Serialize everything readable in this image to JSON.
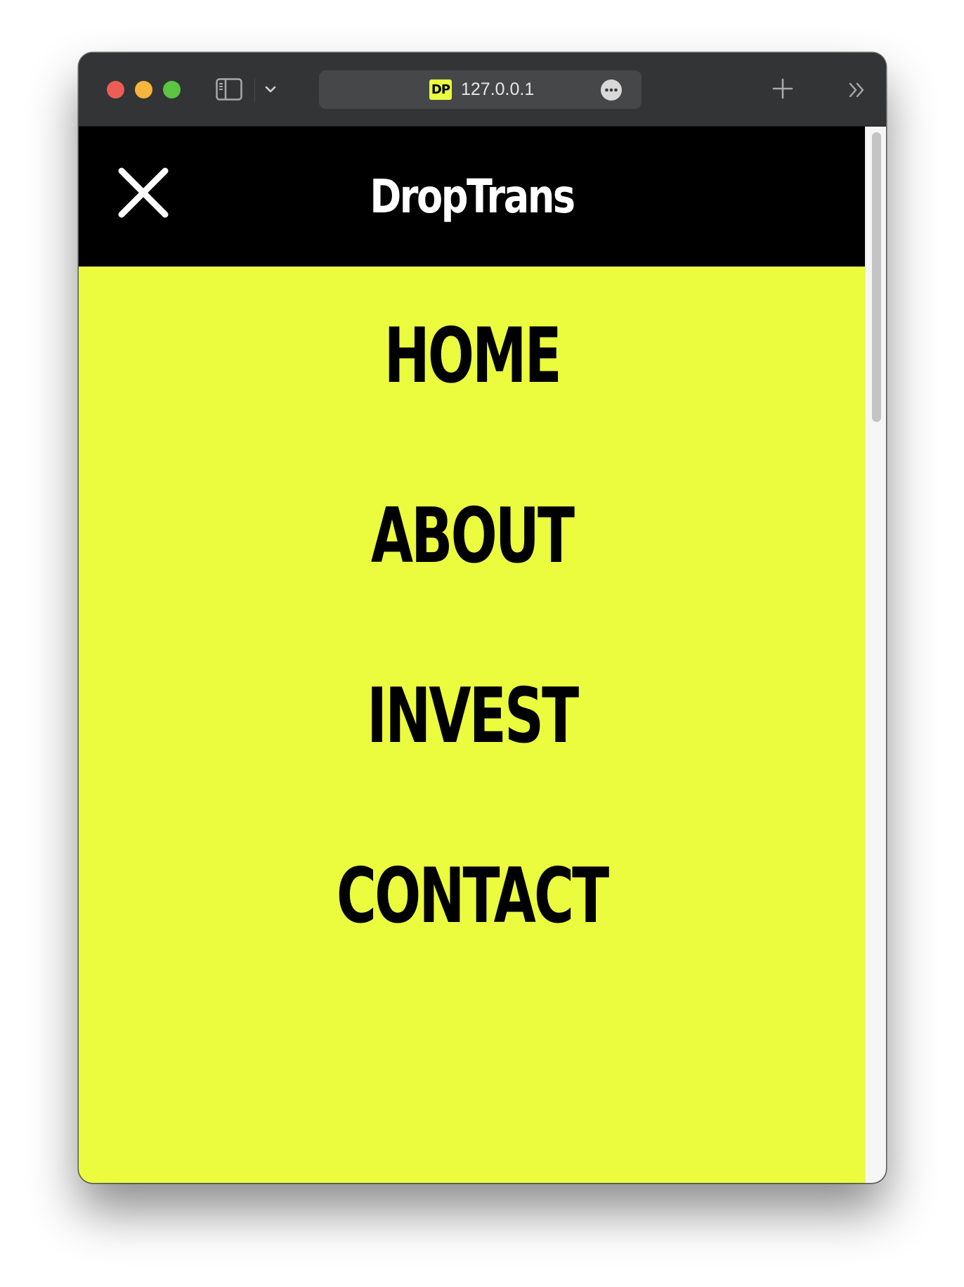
{
  "browser": {
    "url": "127.0.0.1",
    "favicon_text": "DP",
    "colors": {
      "titlebar": "#333436",
      "close": "#ee5d55",
      "minimize": "#f4b63c",
      "maximize": "#5cc543"
    }
  },
  "site": {
    "logo": "DropTrans",
    "colors": {
      "background": "#ebfc3f",
      "header": "#000000",
      "nav_text": "#000000"
    },
    "close_icon": "close-icon",
    "nav": [
      {
        "label": "HOME"
      },
      {
        "label": "ABOUT"
      },
      {
        "label": "INVEST"
      },
      {
        "label": "CONTACT"
      }
    ]
  }
}
